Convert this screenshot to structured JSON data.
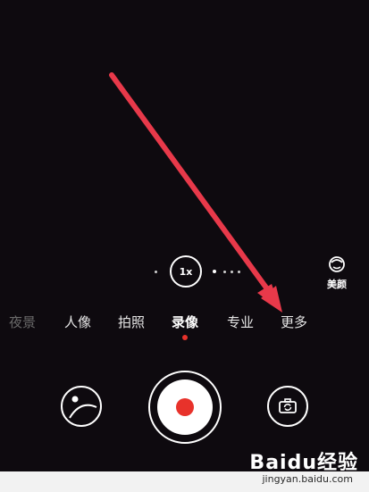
{
  "camera": {
    "zoom_label": "1x",
    "beauty_label": "美颜",
    "modes": [
      {
        "label": "夜景",
        "state": "dim"
      },
      {
        "label": "人像",
        "state": "normal"
      },
      {
        "label": "拍照",
        "state": "normal"
      },
      {
        "label": "录像",
        "state": "active"
      },
      {
        "label": "专业",
        "state": "normal"
      },
      {
        "label": "更多",
        "state": "normal"
      }
    ],
    "active_mode": "录像"
  },
  "icons": [
    "beauty-face-icon",
    "gallery-thumbnail-icon",
    "record-shutter-icon",
    "switch-camera-icon"
  ],
  "colors": {
    "background": "#0e0a0f",
    "record_red": "#e8322b",
    "annotation_arrow": "#e8394a"
  },
  "watermark": {
    "brand": "Baidu经验",
    "url": "jingyan.baidu.com"
  }
}
